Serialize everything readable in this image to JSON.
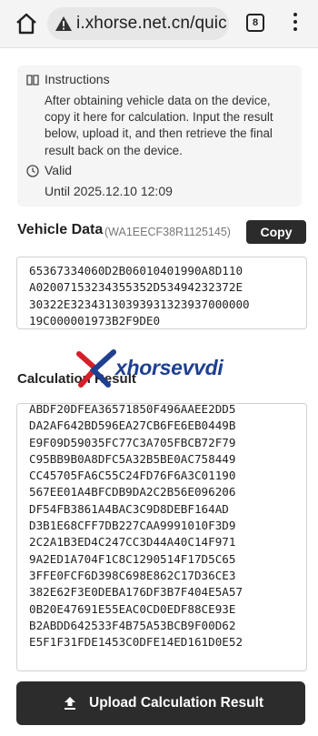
{
  "browser": {
    "url": "i.xhorse.net.cn/quic",
    "tab_count": "8",
    "icons": [
      "home-icon",
      "site-info-icon",
      "tabs-icon",
      "menu-icon"
    ]
  },
  "info": {
    "instructions_title": "Instructions",
    "instructions_text": "After obtaining vehicle data on the device, copy it here for calculation. Input the result below, upload it, and then retrieve the final result back on the device.",
    "valid_title": "Valid",
    "valid_until": "Until 2025.12.10 12:09"
  },
  "vehicle": {
    "label": "Vehicle Data",
    "vin": "(WA1EECF38R1125145)",
    "copy_label": "Copy",
    "data": "65367334060D2B06010401990A8D110\nA02007153234355352D53494232372E\n30322E32343130393931323937000000\n19C000001973B2F9DE0"
  },
  "calculation": {
    "label": "Calculation Result",
    "data": "ABDF20DFEA36571850F496AAEE2DD5\nDA2AF642BD596EA27CB6FE6EB0449B\nE9F09D59035FC77C3A705FBCB72F79\nC95BB9B0A8DFC5A32B5BE0AC758449\nCC45705FA6C55C24FD76F6A3C01190\n567EE01A4BFCDB9DA2C2B56E096206\nDF54FB3861A4BAC3C9D8DEBF164AD\nD3B1E68CFF7DB227CAA9991010F3D9\n2C2A1B3ED4C247CC3D44A40C14F971\n9A2ED1A704F1C8C1290514F17D5C65\n3FFE0FCF6D398C698E862C17D36CE3\n382E62F3E0DEBA176DF3B7F404E5A57\n0B20E47691E55EAC0CD0EDF88CE93E\nB2ABDD642533F4B75A53BCB9F00D62\nE5F1F31FDE1453C0DFE14ED161D0E52"
  },
  "watermark": "xhorsevvdi",
  "upload": {
    "label": "Upload Calculation Result"
  },
  "colors": {
    "button_dark": "#2c2c2c",
    "watermark_blue": "#1f3f8f",
    "watermark_red": "#d4202a",
    "info_bg": "#f5f5f5"
  }
}
